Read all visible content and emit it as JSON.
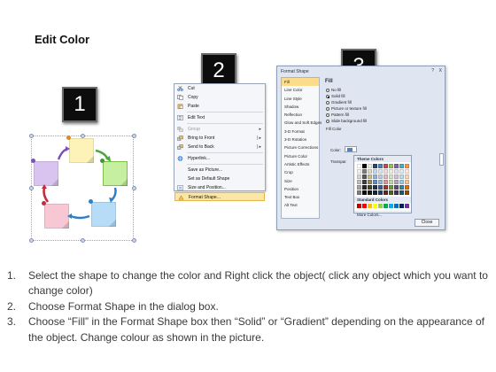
{
  "page_title": "Edit Color",
  "step_badges": [
    "1",
    "2",
    "3"
  ],
  "context_menu": {
    "items": [
      {
        "label": "Cut",
        "icon": "scissors-icon",
        "disabled": false,
        "submenu": false,
        "highlighted": false
      },
      {
        "label": "Copy",
        "icon": "copy-icon",
        "disabled": false,
        "submenu": false,
        "highlighted": false
      },
      {
        "label": "Paste",
        "icon": "clipboard-icon",
        "disabled": false,
        "submenu": false,
        "highlighted": false
      },
      {
        "label": "Edit Text",
        "icon": "text-edit-icon",
        "disabled": false,
        "submenu": false,
        "highlighted": false
      },
      {
        "label": "Group",
        "icon": "group-icon",
        "disabled": true,
        "submenu": true,
        "highlighted": false
      },
      {
        "label": "Bring to Front",
        "icon": "bring-front-icon",
        "disabled": false,
        "submenu": true,
        "highlighted": false
      },
      {
        "label": "Send to Back",
        "icon": "send-back-icon",
        "disabled": false,
        "submenu": true,
        "highlighted": false
      },
      {
        "label": "Hyperlink...",
        "icon": "hyperlink-icon",
        "disabled": false,
        "submenu": false,
        "highlighted": false
      },
      {
        "label": "Save as Picture...",
        "icon": "",
        "disabled": false,
        "submenu": false,
        "highlighted": false
      },
      {
        "label": "Set as Default Shape",
        "icon": "",
        "disabled": false,
        "submenu": false,
        "highlighted": false
      },
      {
        "label": "Size and Position...",
        "icon": "size-position-icon",
        "disabled": false,
        "submenu": false,
        "highlighted": false
      },
      {
        "label": "Format Shape...",
        "icon": "format-shape-icon",
        "disabled": false,
        "submenu": false,
        "highlighted": true
      }
    ]
  },
  "dialog": {
    "title": "Format Shape",
    "help": "?",
    "close_x": "X",
    "nav_items": [
      "Fill",
      "Line Color",
      "Line Style",
      "Shadow",
      "Reflection",
      "Glow and Soft Edges",
      "3-D Format",
      "3-D Rotation",
      "Picture Corrections",
      "Picture Color",
      "Artistic Effects",
      "Crop",
      "Size",
      "Position",
      "Text Box",
      "Alt Text"
    ],
    "active_nav": "Fill",
    "pane_title": "Fill",
    "fill_options": [
      {
        "label": "No fill",
        "selected": false
      },
      {
        "label": "Solid fill",
        "selected": true
      },
      {
        "label": "Gradient fill",
        "selected": false
      },
      {
        "label": "Picture or texture fill",
        "selected": false
      },
      {
        "label": "Pattern fill",
        "selected": false
      },
      {
        "label": "Slide background fill",
        "selected": false
      }
    ],
    "fill_color_label": "Fill Color",
    "color_label": "Color:",
    "transparency_label": "Transpar",
    "palette": {
      "theme_header": "Theme Colors",
      "standard_header": "Standard Colors",
      "more_colors": "More Colors..."
    },
    "close_button": "Close"
  },
  "instructions": [
    {
      "num": "1.",
      "text": "Select the shape to change the color and Right click the object( click any object which you want to change color)"
    },
    {
      "num": "2.",
      "text": "Choose Format Shape in the dialog box."
    },
    {
      "num": "3.",
      "text": "Choose “Fill” in the Format Shape box then “Solid” or “Gradient” depending on the appearance of the object. Change colour as shown in the picture."
    }
  ],
  "colors": {
    "note_yellow": "#fdf3b8",
    "note_green": "#c6ef9f",
    "note_blue": "#b7dcf7",
    "note_pink": "#f7c8d3",
    "note_purple": "#d9c4ef",
    "highlight": "#fbe6a7",
    "badge": "#0c0c0c"
  }
}
